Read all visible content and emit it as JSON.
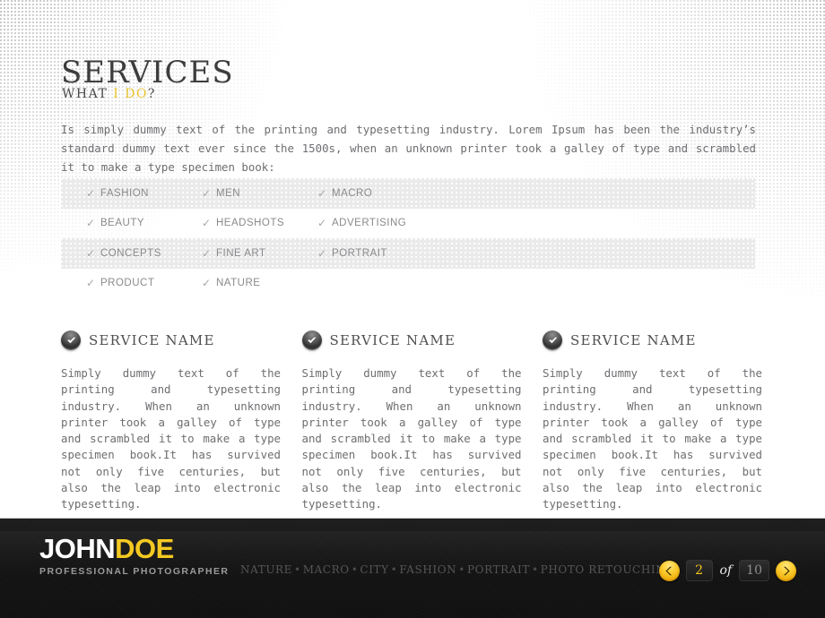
{
  "header": {
    "title": "SERVICES",
    "subtitle_prefix": "WHAT ",
    "subtitle_highlight": "I DO",
    "subtitle_suffix": "?"
  },
  "intro": {
    "text": "Is simply dummy text of the printing and typesetting industry. Lorem Ipsum has been the industry’s standard dummy text ever since the 1500s, when an unknown printer took a galley of type and scrambled it to make a type specimen book:"
  },
  "services": {
    "check_icon": "check-icon",
    "rows": [
      {
        "shaded": true,
        "items": [
          "FASHION",
          "MEN",
          "MACRO"
        ]
      },
      {
        "shaded": false,
        "items": [
          "BEAUTY",
          "HEADSHOTS",
          "ADVERTISING"
        ]
      },
      {
        "shaded": true,
        "items": [
          "CONCEPTS",
          "FINE ART",
          "PORTRAIT"
        ]
      },
      {
        "shaded": false,
        "items": [
          "PRODUCT",
          "NATURE",
          ""
        ]
      }
    ]
  },
  "columns": [
    {
      "icon": "check-circle-icon",
      "title": "SERVICE NAME",
      "body": "Simply dummy text of the printing and typesetting industry. When an unknown printer took a galley of type and scrambled it to make a type specimen book.It has survived not only five centuries, but also the leap into electronic typesetting."
    },
    {
      "icon": "check-circle-icon",
      "title": "SERVICE NAME",
      "body": "Simply dummy text of the printing and typesetting industry. When an unknown printer took a galley of type and scrambled it to make a type specimen book.It has survived not only five centuries, but also the leap into electronic typesetting."
    },
    {
      "icon": "check-circle-icon",
      "title": "SERVICE NAME",
      "body": "Simply dummy text of the printing and typesetting industry. When an unknown printer took a galley of type and scrambled it to make a type specimen book.It has survived not only five centuries, but also the leap into electronic typesetting."
    }
  ],
  "footer": {
    "brand_first": "JOHN",
    "brand_second": "DOE",
    "tagline": "PROFESSIONAL PHOTOGRAPHER",
    "nav_items": [
      "NATURE",
      "MACRO",
      "CITY",
      "FASHION",
      "PORTRAIT",
      "PHOTO RETOUCHING"
    ],
    "nav_separator": "•",
    "pager": {
      "prev_icon": "chevron-left-icon",
      "next_icon": "chevron-right-icon",
      "current": "2",
      "of_label": "of",
      "total": "10"
    }
  },
  "colors": {
    "accent_yellow": "#f4c81d",
    "subtitle_yellow": "#e9c32b",
    "footer_bg": "#161616",
    "text_gray": "#6e6e72",
    "row_shade": "#eaeaea"
  }
}
